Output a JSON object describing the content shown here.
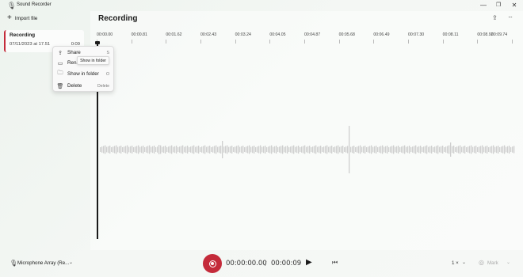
{
  "window": {
    "title": "Sound Recorder",
    "icons": {
      "app": "microphone-icon",
      "minimize": "minimize-icon",
      "maximize": "restore-icon",
      "close": "close-icon"
    }
  },
  "sidebar": {
    "import_label": "Import file",
    "recordings": [
      {
        "name": "Recording",
        "date": "07/11/2023 at 17.51",
        "duration": "0:09"
      }
    ]
  },
  "context_menu": {
    "items": [
      {
        "label": "Share",
        "shortcut": "S",
        "icon": "share-icon"
      },
      {
        "label": "Rena",
        "shortcut": "",
        "icon": "rename-icon"
      },
      {
        "label": "Show in folder",
        "shortcut": "O",
        "icon": "folder-icon"
      },
      {
        "label": "Delete",
        "shortcut": "Delete",
        "icon": "trash-icon"
      }
    ],
    "tooltip": "Show in folder"
  },
  "main": {
    "title": "Recording",
    "timeline_ticks": [
      "00:00.00",
      "00:00.81",
      "00:01.62",
      "00:02.43",
      "00:03.24",
      "00:04.05",
      "00:04.87",
      "00:05.68",
      "00:06.49",
      "00:07.30",
      "00:08.11",
      "00:08.92",
      "00:09.74"
    ]
  },
  "player": {
    "microphone": "Microphone Array (Re...",
    "current_time": "00:00:00.00",
    "separator": "/",
    "total_time": "00:00:09",
    "speed": "1 ×",
    "mark_label": "Mark"
  },
  "colors": {
    "accent": "#c42b3a",
    "waveform": "#cfcfcf"
  }
}
